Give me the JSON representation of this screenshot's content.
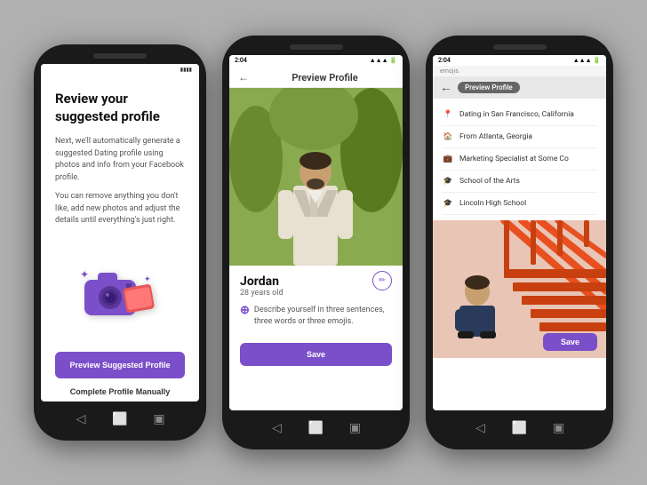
{
  "background_color": "#b0b0b0",
  "accent_color": "#7b4fc9",
  "phone1": {
    "status_bar": "▼ ▲ ▼",
    "title": "eview your suggested rofile",
    "title_full": "Review your suggested profile",
    "body1": "Next, we'll automatically generate a suggested Dating profile using photos and info from your Facebook profile.",
    "body2": "You can remove anything you don't like, add new photos and adjust the details until everything's just right.",
    "btn_preview": "Preview Suggested Profile",
    "btn_manual": "Complete Profile Manually"
  },
  "phone2": {
    "status_time": "2:04",
    "status_signal": "▲▲▲",
    "header_label": "Preview Profile",
    "profile_name": "Jordan",
    "profile_age": "28 years old",
    "describe_placeholder": "Describe yourself in three sentences, three words or three emojis.",
    "save_label": "Save",
    "edit_icon": "✏"
  },
  "phone3": {
    "status_time": "2:04",
    "signal": "▲▲▲",
    "emojis_label": "emojis.",
    "header_label": "Preview Profile",
    "back_label": "←",
    "info_items": [
      {
        "icon": "📍",
        "text": "Dating in San Francisco, California"
      },
      {
        "icon": "🏠",
        "text": "From Atlanta, Georgia"
      },
      {
        "icon": "💼",
        "text": "Marketing Specialist at Some Co"
      },
      {
        "icon": "🎓",
        "text": "School of the Arts"
      },
      {
        "icon": "🎓",
        "text": "Lincoln High School"
      }
    ],
    "save_label": "Save"
  },
  "nav_icons": {
    "back": "◁",
    "home": "⬜",
    "recent": "▣"
  }
}
